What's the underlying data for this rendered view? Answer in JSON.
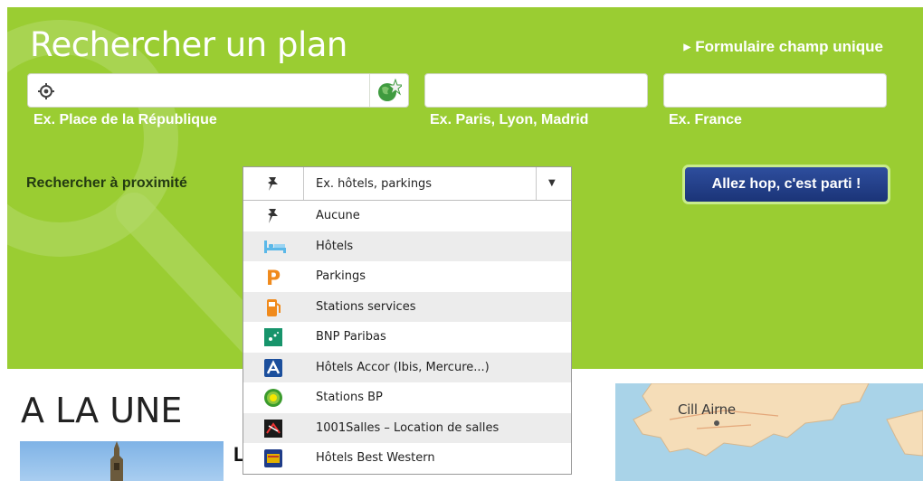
{
  "search": {
    "title": "Rechercher un plan",
    "single_field_link": "Formulaire champ unique",
    "fields": [
      {
        "value": "",
        "hint": "Ex. Place de la République"
      },
      {
        "value": "",
        "hint": "Ex. Paris, Lyon, Madrid"
      },
      {
        "value": "",
        "hint": "Ex. France"
      }
    ],
    "proximity_label": "Rechercher à proximité",
    "submit_label": "Allez hop, c'est parti !"
  },
  "proximity_dropdown": {
    "selected_text": "Ex. hôtels, parkings",
    "options": [
      {
        "label": "Aucune",
        "icon": "pushpin-icon"
      },
      {
        "label": "Hôtels",
        "icon": "hotel-bed-icon"
      },
      {
        "label": "Parkings",
        "icon": "parking-icon"
      },
      {
        "label": "Stations services",
        "icon": "fuel-pump-icon"
      },
      {
        "label": "BNP Paribas",
        "icon": "bnp-paribas-icon"
      },
      {
        "label": "Hôtels Accor (Ibis, Mercure...)",
        "icon": "accor-icon"
      },
      {
        "label": "Stations BP",
        "icon": "bp-icon"
      },
      {
        "label": "1001Salles – Location de salles",
        "icon": "1001salles-icon"
      },
      {
        "label": "Hôtels Best Western",
        "icon": "best-western-icon"
      }
    ]
  },
  "headline": {
    "section_title": "A LA UNE",
    "article_initial": "L"
  },
  "map": {
    "place_label": "Cill Airne"
  },
  "colors": {
    "panel_green": "#9acd32",
    "button_blue": "#1f3c88"
  }
}
